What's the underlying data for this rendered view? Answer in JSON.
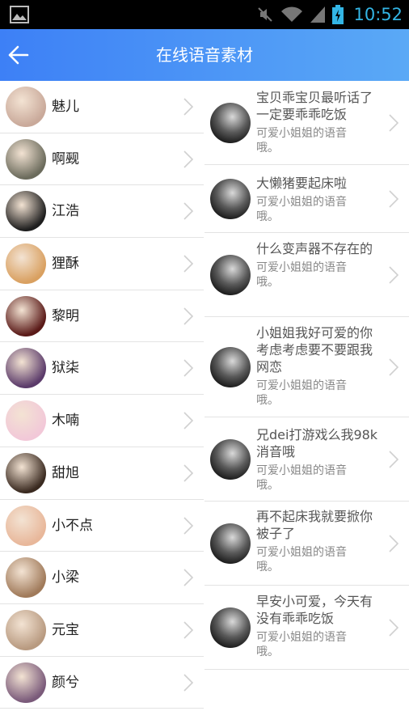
{
  "status_bar": {
    "time": "10:52",
    "accent": "#33b5e5"
  },
  "header": {
    "title": "在线语音素材",
    "back_icon": "arrow-left-icon"
  },
  "left_list": [
    {
      "name": "魅儿",
      "avatar_color": "#c9a99a"
    },
    {
      "name": "啊觋",
      "avatar_color": "#6b6b5c"
    },
    {
      "name": "江浩",
      "avatar_color": "#1e1e1e"
    },
    {
      "name": "狸酥",
      "avatar_color": "#d9a060"
    },
    {
      "name": "黎明",
      "avatar_color": "#5a1a18"
    },
    {
      "name": "狱柒",
      "avatar_color": "#5b3b6a"
    },
    {
      "name": "木喃",
      "avatar_color": "#f2c8d8"
    },
    {
      "name": "甜旭",
      "avatar_color": "#3a2a20"
    },
    {
      "name": "小不点",
      "avatar_color": "#e8b79a"
    },
    {
      "name": "小梁",
      "avatar_color": "#a07a5a"
    },
    {
      "name": "元宝",
      "avatar_color": "#b89a80"
    },
    {
      "name": "颜兮",
      "avatar_color": "#7a5a7a"
    }
  ],
  "right_list": [
    {
      "title": "宝贝乖宝贝最听话了一定要乖乖吃饭",
      "subtitle": "可爱小姐姐的语音哦。"
    },
    {
      "title": "大懒猪要起床啦",
      "subtitle": "可爱小姐姐的语音哦。"
    },
    {
      "title": "什么变声器不存在的",
      "subtitle": "可爱小姐姐的语音哦。"
    },
    {
      "title": "小姐姐我好可爱的你考虑考虑要不要跟我网恋",
      "subtitle": "可爱小姐姐的语音哦。"
    },
    {
      "title": "兄dei打游戏么我98k消音哦",
      "subtitle": "可爱小姐姐的语音哦。"
    },
    {
      "title": "再不起床我就要掀你被子了",
      "subtitle": "可爱小姐姐的语音哦。"
    },
    {
      "title": "早安小可爱，今天有没有乖乖吃饭",
      "subtitle": "可爱小姐姐的语音哦。"
    }
  ]
}
